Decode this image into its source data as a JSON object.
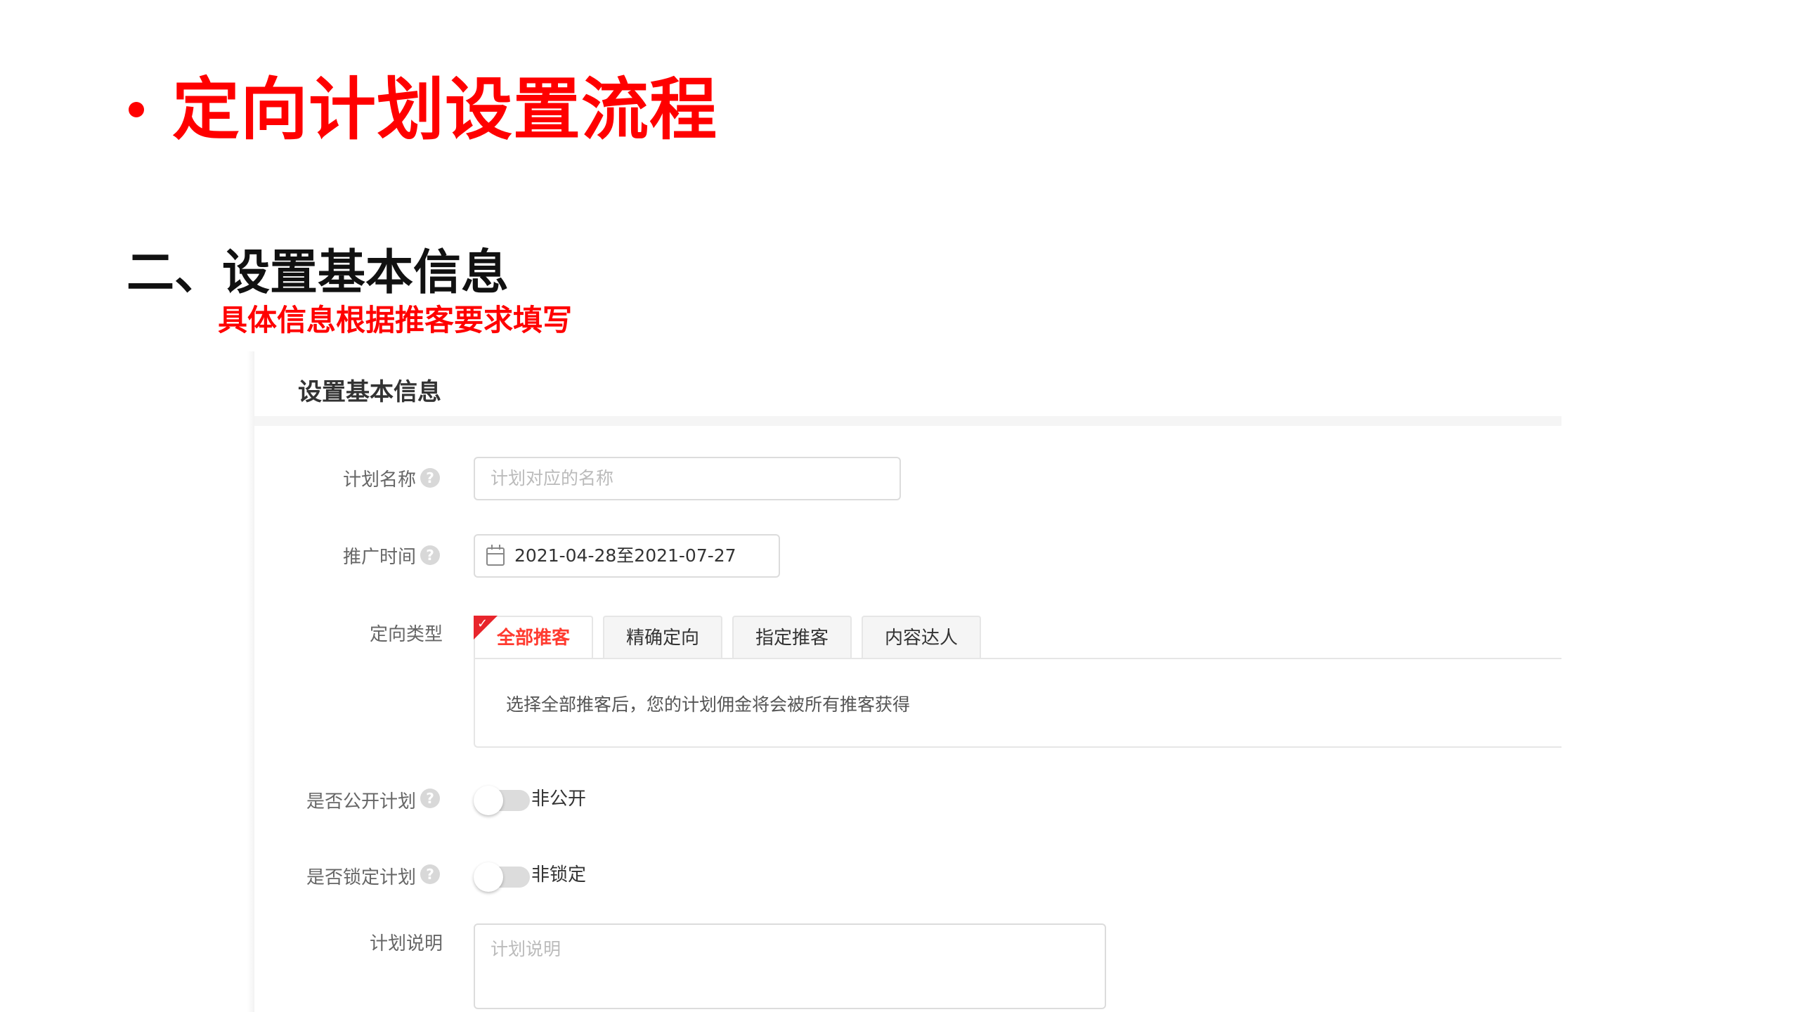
{
  "slide": {
    "title": "定向计划设置流程",
    "section_title": "二、设置基本信息",
    "section_subtitle": "具体信息根据推客要求填写"
  },
  "form": {
    "header": "设置基本信息",
    "plan_name": {
      "label": "计划名称",
      "placeholder": "计划对应的名称",
      "help_icon": "question-circle-icon"
    },
    "promo_time": {
      "label": "推广时间",
      "value": "2021-04-28至2021-07-27",
      "icon": "calendar-icon",
      "help_icon": "question-circle-icon"
    },
    "target_type": {
      "label": "定向类型",
      "tabs": [
        {
          "label": "全部推客",
          "active": true
        },
        {
          "label": "精确定向",
          "active": false
        },
        {
          "label": "指定推客",
          "active": false
        },
        {
          "label": "内容达人",
          "active": false
        }
      ],
      "description": "选择全部推客后，您的计划佣金将会被所有推客获得"
    },
    "is_public": {
      "label": "是否公开计划",
      "state_label": "非公开",
      "on": false
    },
    "is_locked": {
      "label": "是否锁定计划",
      "state_label": "非锁定",
      "on": false
    },
    "plan_desc": {
      "label": "计划说明",
      "placeholder": "计划说明"
    }
  },
  "colors": {
    "accent": "#ff0000",
    "tab_active": "#ff3b30",
    "check_corner": "#e8252c"
  }
}
